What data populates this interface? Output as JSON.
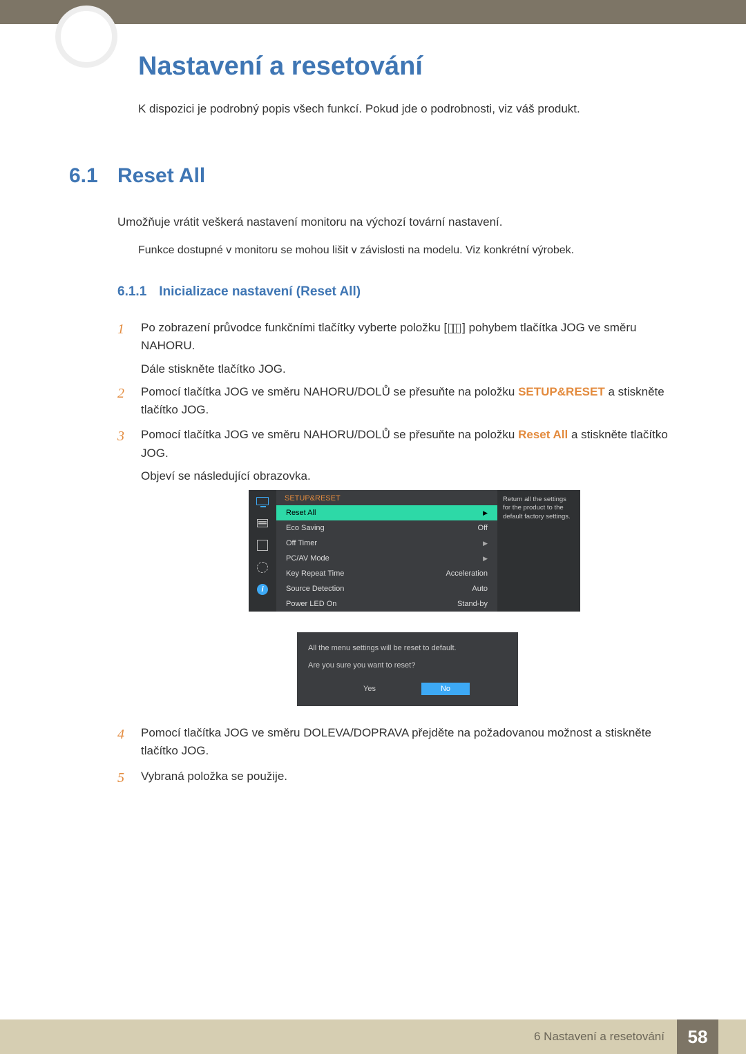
{
  "chapter": {
    "title": "Nastavení a resetování",
    "intro": "K dispozici je podrobný popis všech funkcí. Pokud jde o podrobnosti, viz váš produkt."
  },
  "section": {
    "number": "6.1",
    "title": "Reset All",
    "desc": "Umožňuje vrátit veškerá nastavení monitoru na výchozí tovární nastavení.",
    "note": "Funkce dostupné v monitoru se mohou lišit v závislosti na modelu. Viz konkrétní výrobek."
  },
  "subsection": {
    "number": "6.1.1",
    "title": "Inicializace nastavení (Reset All)"
  },
  "steps": {
    "s1": {
      "num": "1",
      "a": "Po zobrazení průvodce funkčními tlačítky vyberte položku [",
      "b": "] pohybem tlačítka JOG ve směru NAHORU.",
      "sub": "Dále stiskněte tlačítko JOG."
    },
    "s2": {
      "num": "2",
      "a": "Pomocí tlačítka JOG ve směru NAHORU/DOLŮ se přesuňte na položku ",
      "bold": "SETUP&RESET",
      "b": " a stiskněte tlačítko JOG."
    },
    "s3": {
      "num": "3",
      "a": "Pomocí tlačítka JOG ve směru NAHORU/DOLŮ se přesuňte na položku ",
      "bold": "Reset All",
      "b": " a stiskněte tlačítko JOG.",
      "sub": "Objeví se následující obrazovka."
    },
    "s4": {
      "num": "4",
      "text": "Pomocí tlačítka JOG ve směru DOLEVA/DOPRAVA přejděte na požadovanou možnost a stiskněte tlačítko JOG."
    },
    "s5": {
      "num": "5",
      "text": "Vybraná položka se použije."
    }
  },
  "osd": {
    "header": "SETUP&RESET",
    "tip": "Return all the settings for the product to the default factory settings.",
    "rows": [
      {
        "label": "Reset All",
        "value": "",
        "arrow": true,
        "sel": true
      },
      {
        "label": "Eco Saving",
        "value": "Off"
      },
      {
        "label": "Off Timer",
        "value": "",
        "arrow": true
      },
      {
        "label": "PC/AV Mode",
        "value": "",
        "arrow": true
      },
      {
        "label": "Key Repeat Time",
        "value": "Acceleration"
      },
      {
        "label": "Source Detection",
        "value": "Auto"
      },
      {
        "label": "Power LED On",
        "value": "Stand-by"
      }
    ]
  },
  "dialog": {
    "line1": "All the menu settings will be reset to default.",
    "line2": "Are you sure you want to reset?",
    "yes": "Yes",
    "no": "No"
  },
  "footer": {
    "label": "6 Nastavení a resetování",
    "page": "58"
  }
}
